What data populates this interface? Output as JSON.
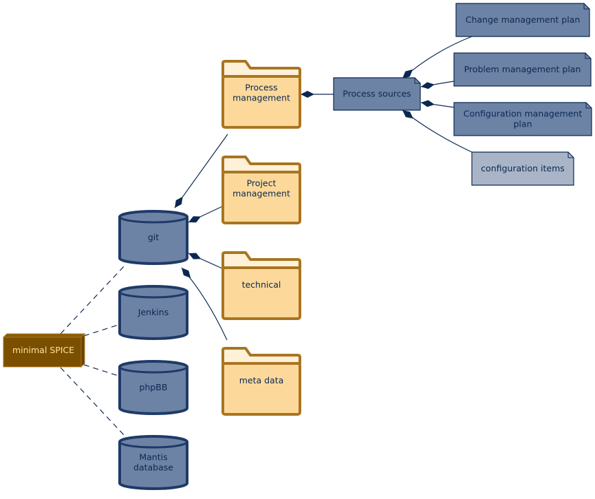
{
  "colors": {
    "node_fill": "#7b4f00",
    "node_text": "#fde3a0",
    "db_fill": "#6d83a6",
    "db_stroke": "#1f3a68",
    "folder_fill": "#fcd99b",
    "folder_tab": "#fff0d8",
    "folder_stroke": "#a87520",
    "artifact_fill": "#6d83a6",
    "artifact_light_fill": "#a9b5c7",
    "edge": "#0b2850"
  },
  "node": {
    "label": "minimal SPICE"
  },
  "databases": [
    {
      "lines": [
        "git"
      ]
    },
    {
      "lines": [
        "Jenkins"
      ]
    },
    {
      "lines": [
        "phpBB"
      ]
    },
    {
      "lines": [
        "Mantis",
        "database"
      ]
    }
  ],
  "folders": [
    {
      "lines": [
        "Process",
        "management"
      ]
    },
    {
      "lines": [
        "Project",
        "management"
      ]
    },
    {
      "lines": [
        "technical"
      ]
    },
    {
      "lines": [
        "meta data"
      ]
    }
  ],
  "artifacts": [
    {
      "lines": [
        "Process sources"
      ]
    },
    {
      "lines": [
        "Change management plan"
      ]
    },
    {
      "lines": [
        "Problem management plan"
      ]
    },
    {
      "lines": [
        "Configuration management",
        "plan"
      ]
    },
    {
      "lines": [
        "configuration items"
      ]
    }
  ]
}
